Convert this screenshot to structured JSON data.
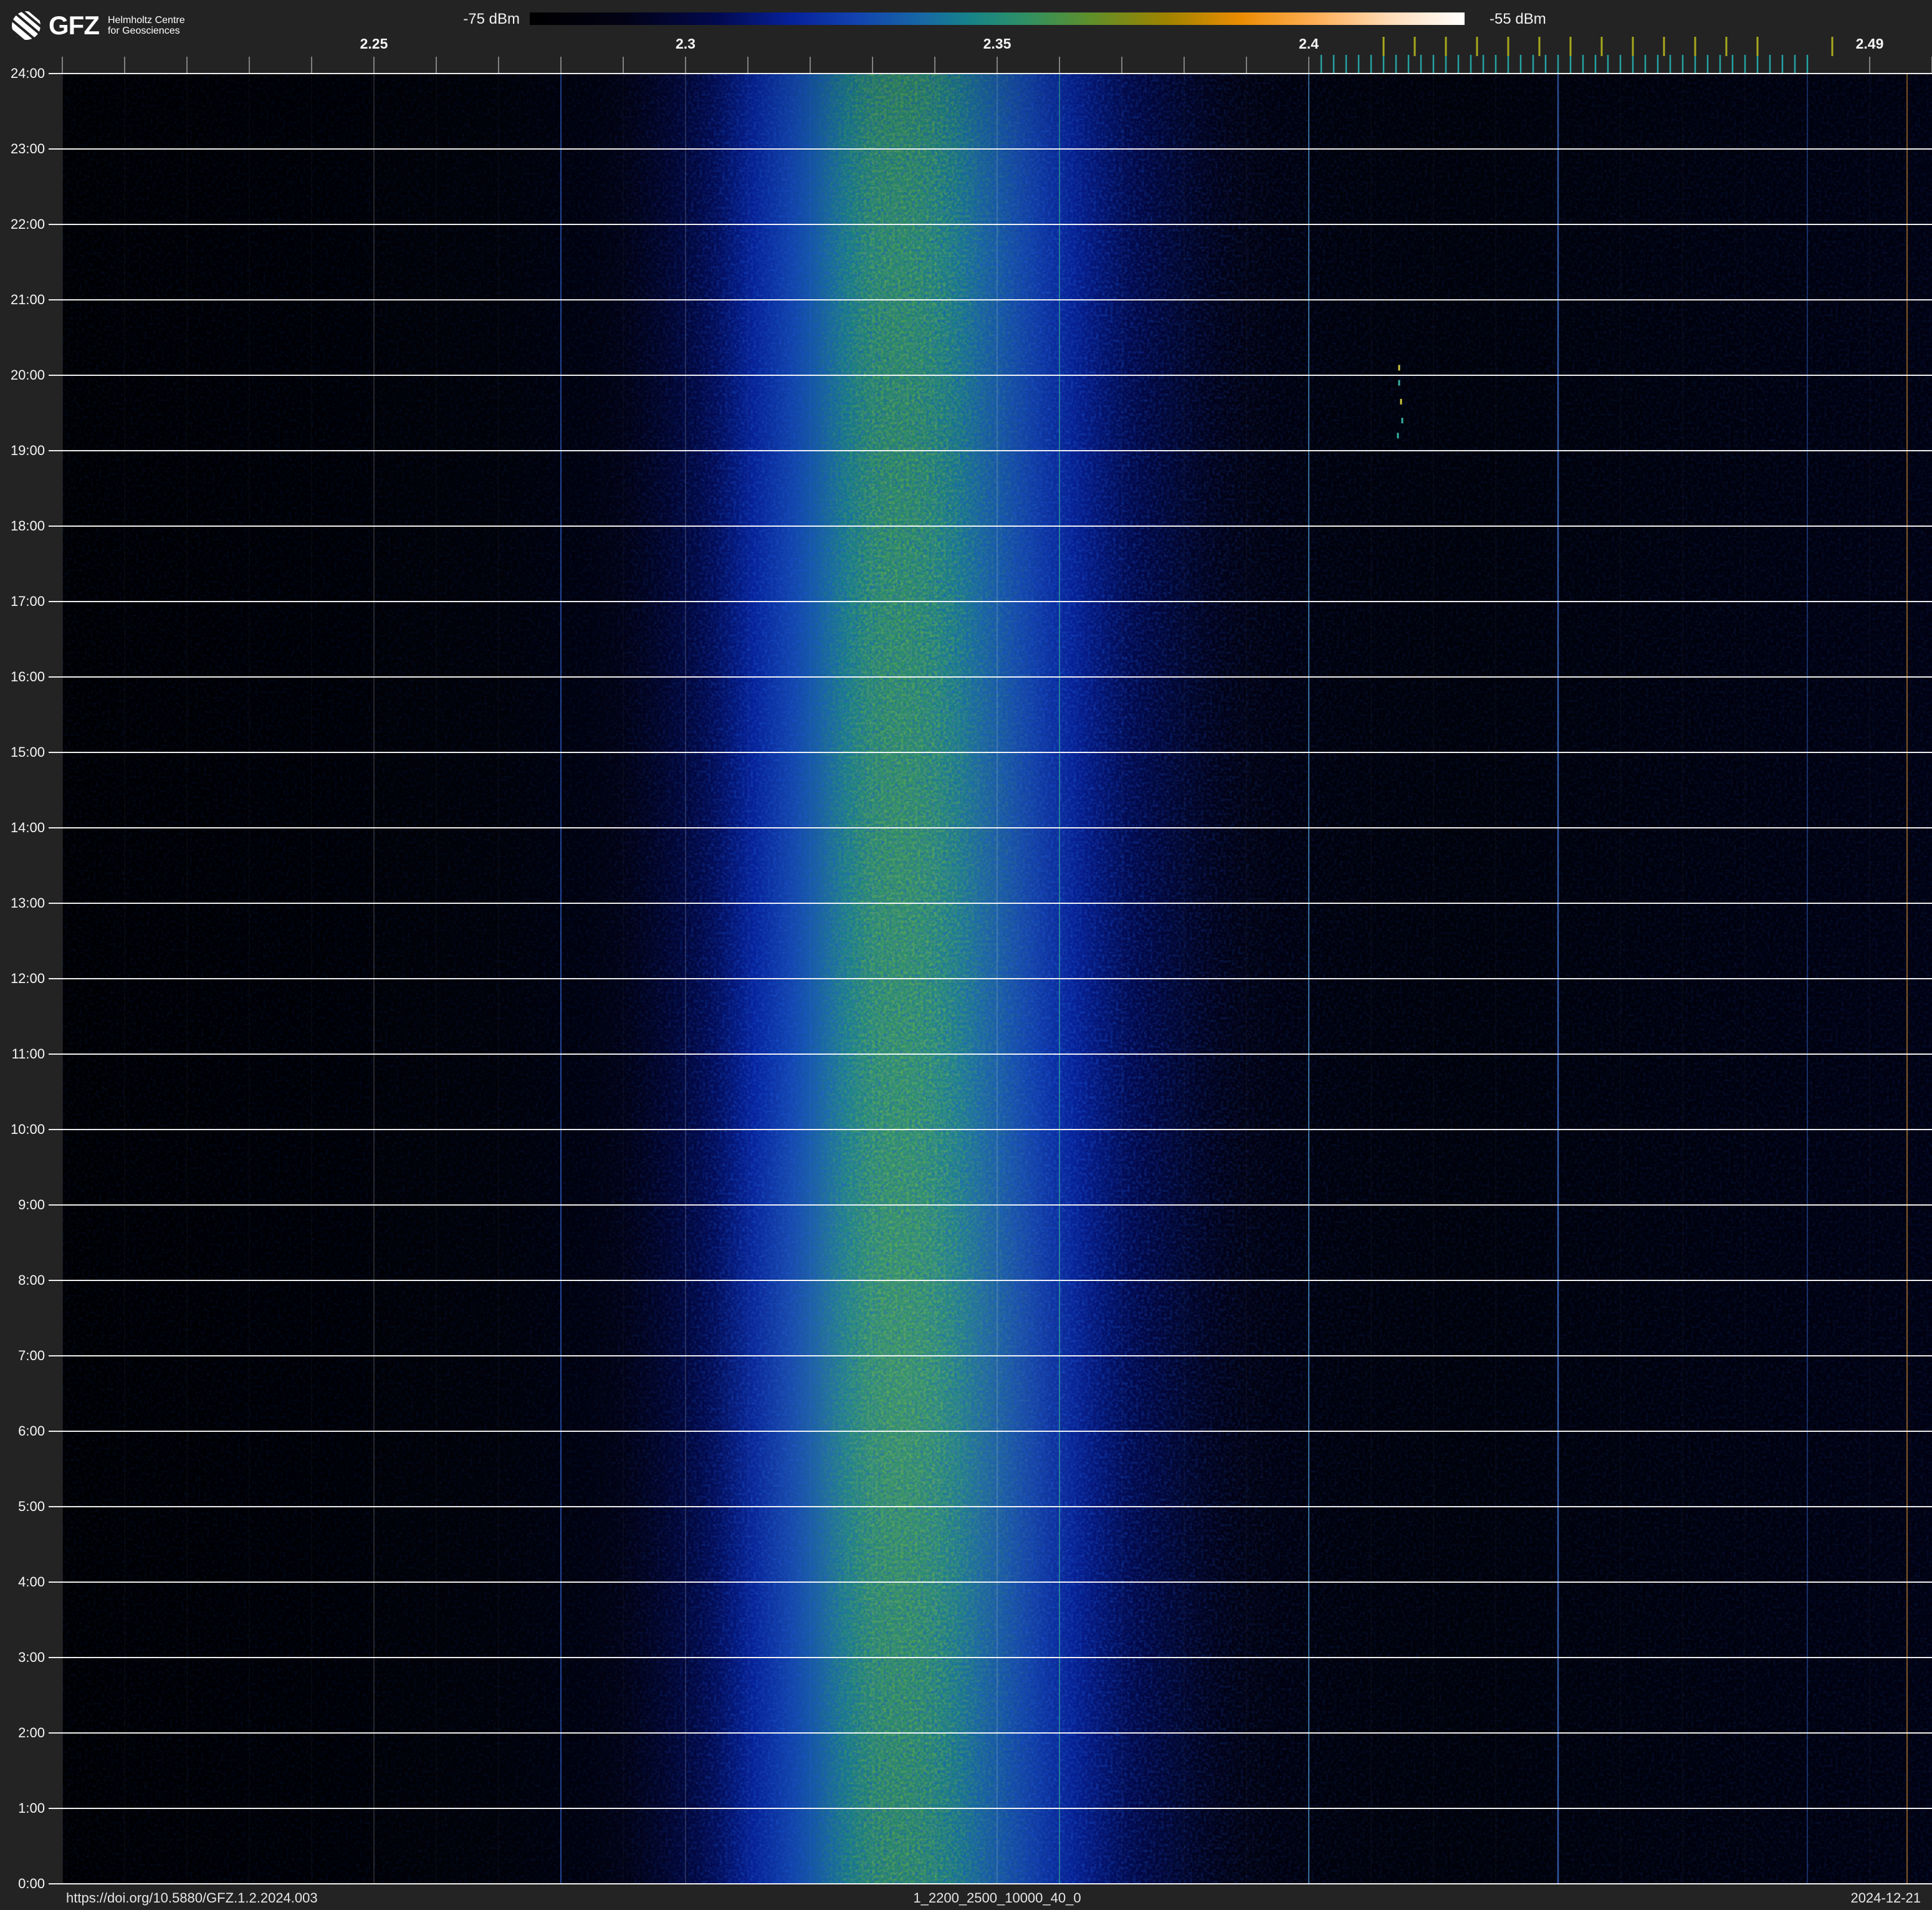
{
  "brand": {
    "name": "GFZ",
    "line1": "Helmholtz Centre",
    "line2": "for Geosciences"
  },
  "colorbar": {
    "min_label": "-75 dBm",
    "max_label": "-55 dBm"
  },
  "footer": {
    "doi": "https://doi.org/10.5880/GFZ.1.2.2024.003",
    "dataset": "1_2200_2500_10000_40_0",
    "date": "2024-12-21"
  },
  "chart_data": {
    "type": "heatmap",
    "title": "24-hour radio-frequency spectrogram (waterfall), 2.2-2.5 GHz",
    "x_unit": "GHz",
    "x_range": [
      2.2,
      2.5
    ],
    "x_major_ticks": [
      {
        "value": 2.25,
        "label": "2.25"
      },
      {
        "value": 2.3,
        "label": "2.3"
      },
      {
        "value": 2.35,
        "label": "2.35"
      },
      {
        "value": 2.4,
        "label": "2.4"
      },
      {
        "value": 2.49,
        "label": "2.49"
      }
    ],
    "x_minor_tick_step_ghz": 0.01,
    "major_grid_ghz": [
      2.25,
      2.3,
      2.35,
      2.4
    ],
    "y_axis": {
      "unit": "time of day",
      "hours_span": 24,
      "labels": [
        "24:00",
        "23:00",
        "22:00",
        "21:00",
        "20:00",
        "19:00",
        "18:00",
        "17:00",
        "16:00",
        "15:00",
        "14:00",
        "13:00",
        "12:00",
        "11:00",
        "10:00",
        "9:00",
        "8:00",
        "7:00",
        "6:00",
        "5:00",
        "4:00",
        "3:00",
        "2:00",
        "1:00",
        "0:00"
      ]
    },
    "power_scale": {
      "min_dbm": -75,
      "max_dbm": -55
    },
    "colormap": [
      [
        0.0,
        "#000000"
      ],
      [
        0.1,
        "#020215"
      ],
      [
        0.2,
        "#02094e"
      ],
      [
        0.28,
        "#06219a"
      ],
      [
        0.35,
        "#1243b0"
      ],
      [
        0.42,
        "#1768a4"
      ],
      [
        0.47,
        "#16838a"
      ],
      [
        0.53,
        "#2f9064"
      ],
      [
        0.6,
        "#5f8f2a"
      ],
      [
        0.68,
        "#9e8300"
      ],
      [
        0.76,
        "#ea8c02"
      ],
      [
        0.84,
        "#ffae55"
      ],
      [
        0.92,
        "#ffdcb8"
      ],
      [
        1.0,
        "#ffffff"
      ]
    ],
    "spectral_profile_ghz_dbm": [
      [
        2.2,
        -74.8
      ],
      [
        2.24,
        -74.6
      ],
      [
        2.27,
        -74.3
      ],
      [
        2.285,
        -73.6
      ],
      [
        2.295,
        -72.5
      ],
      [
        2.303,
        -71.2
      ],
      [
        2.31,
        -69.6
      ],
      [
        2.316,
        -68.2
      ],
      [
        2.321,
        -66.9
      ],
      [
        2.326,
        -65.7
      ],
      [
        2.33,
        -64.9
      ],
      [
        2.334,
        -64.6
      ],
      [
        2.338,
        -64.9
      ],
      [
        2.343,
        -65.7
      ],
      [
        2.349,
        -66.9
      ],
      [
        2.356,
        -68.3
      ],
      [
        2.364,
        -69.8
      ],
      [
        2.373,
        -71.3
      ],
      [
        2.382,
        -72.5
      ],
      [
        2.391,
        -73.4
      ],
      [
        2.403,
        -73.9
      ],
      [
        2.423,
        -74.2
      ],
      [
        2.443,
        -74.0
      ],
      [
        2.463,
        -73.8
      ],
      [
        2.483,
        -73.6
      ],
      [
        2.5,
        -73.5
      ]
    ],
    "broadband_signal": {
      "center_ghz": 2.333,
      "green_core_ghz": [
        2.321,
        2.346
      ],
      "blue_extent_ghz": [
        2.29,
        2.4
      ],
      "peak_dbm": -64.6,
      "presence": "continuous 0:00-24:00"
    },
    "narrowband_carriers": [
      {
        "ghz": 2.28,
        "color": "#2e5cc8",
        "opacity": 0.75,
        "width": 2
      },
      {
        "ghz": 2.36,
        "color": "#2aa39b",
        "opacity": 0.7,
        "width": 2
      },
      {
        "ghz": 2.4,
        "color": "#3f86c0",
        "opacity": 0.8,
        "width": 2
      },
      {
        "ghz": 2.44,
        "color": "#3e6fd0",
        "opacity": 0.8,
        "width": 2.5
      },
      {
        "ghz": 2.48,
        "color": "#2c55b8",
        "opacity": 0.5,
        "width": 2
      },
      {
        "ghz": 2.496,
        "color": "#b07c2e",
        "opacity": 0.75,
        "width": 2
      }
    ],
    "cyan_channel_ticks": {
      "start_ghz": 2.402,
      "end_ghz": 2.48,
      "step_ghz": 0.002,
      "color": "#25a3a3"
    },
    "yellow_channel_ticks": {
      "values_ghz": [
        2.412,
        2.417,
        2.422,
        2.427,
        2.432,
        2.437,
        2.442,
        2.447,
        2.452,
        2.457,
        2.462,
        2.467,
        2.472,
        2.484
      ],
      "color": "#a8a81e"
    },
    "sporadic_bursts": [
      {
        "ghz": 2.4145,
        "hour": 20.1,
        "color": "#cfc93c"
      },
      {
        "ghz": 2.4145,
        "hour": 19.9,
        "color": "#39b2a2"
      },
      {
        "ghz": 2.4148,
        "hour": 19.65,
        "color": "#cfc93c"
      },
      {
        "ghz": 2.415,
        "hour": 19.4,
        "color": "#39b2a2"
      },
      {
        "ghz": 2.4143,
        "hour": 19.2,
        "color": "#39b2a2"
      }
    ]
  }
}
